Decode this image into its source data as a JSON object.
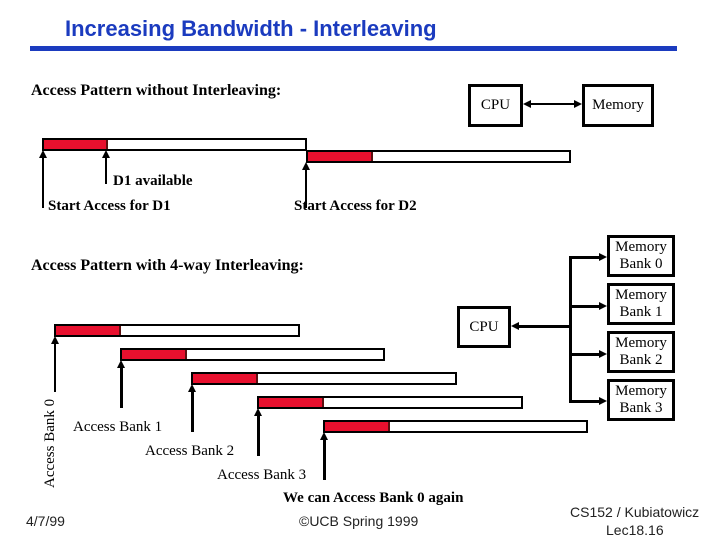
{
  "slide": {
    "title": "Increasing Bandwidth - Interleaving",
    "title_color": "#1b3bbf",
    "accent_red": "#e8102e"
  },
  "no_interleave": {
    "heading": "Access Pattern without Interleaving:",
    "cpu_label": "CPU",
    "memory_label": "Memory",
    "d1_available": "D1 available",
    "start_d1": "Start Access for D1",
    "start_d2": "Start Access for D2"
  },
  "interleave": {
    "heading": "Access Pattern with 4-way Interleaving:",
    "cpu_label": "CPU",
    "banks": [
      {
        "line1": "Memory",
        "line2": "Bank 0"
      },
      {
        "line1": "Memory",
        "line2": "Bank 1"
      },
      {
        "line1": "Memory",
        "line2": "Bank 2"
      },
      {
        "line1": "Memory",
        "line2": "Bank 3"
      }
    ],
    "access_bank0": "Access Bank 0",
    "access_bank1": "Access Bank 1",
    "access_bank2": "Access Bank 2",
    "access_bank3": "Access Bank 3",
    "again": "We can Access Bank 0 again"
  },
  "footer": {
    "date": "4/7/99",
    "copyright": "©UCB Spring 1999",
    "course": "CS152 / Kubiatowicz",
    "lecture": "Lec18.16"
  }
}
